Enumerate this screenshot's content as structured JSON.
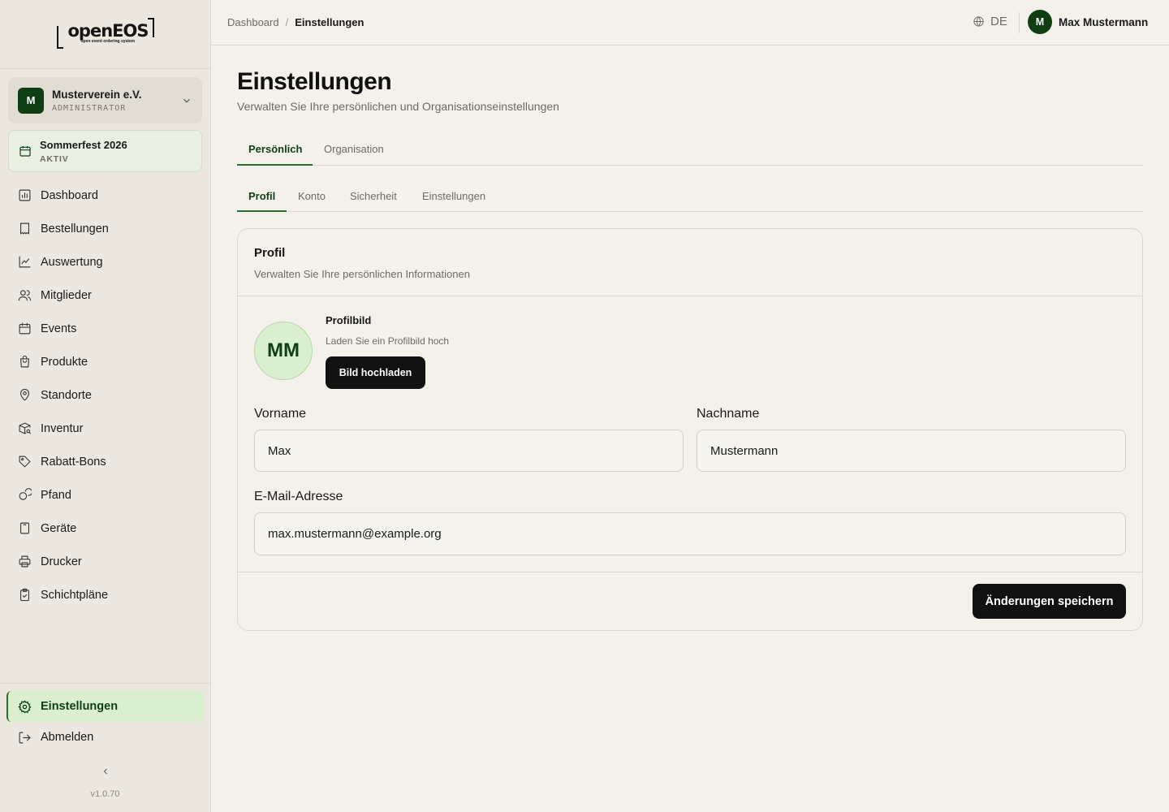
{
  "logo": {
    "text": "openEOS",
    "subtitle": "open event ordering system"
  },
  "org": {
    "initial": "M",
    "name": "Musterverein e.V.",
    "role": "ADMINISTRATOR"
  },
  "event": {
    "name": "Sommerfest 2026",
    "status": "AKTIV"
  },
  "sidebar": {
    "items": [
      {
        "label": "Dashboard",
        "icon": "chart-bar-icon"
      },
      {
        "label": "Bestellungen",
        "icon": "receipt-icon"
      },
      {
        "label": "Auswertung",
        "icon": "trend-line-icon"
      },
      {
        "label": "Mitglieder",
        "icon": "users-icon"
      },
      {
        "label": "Events",
        "icon": "calendar-icon"
      },
      {
        "label": "Produkte",
        "icon": "shopping-bag-icon"
      },
      {
        "label": "Standorte",
        "icon": "map-pin-icon"
      },
      {
        "label": "Inventur",
        "icon": "package-search-icon"
      },
      {
        "label": "Rabatt-Bons",
        "icon": "tag-icon"
      },
      {
        "label": "Pfand",
        "icon": "coins-icon"
      },
      {
        "label": "Geräte",
        "icon": "tablet-icon"
      },
      {
        "label": "Drucker",
        "icon": "printer-icon"
      },
      {
        "label": "Schichtpläne",
        "icon": "clipboard-check-icon"
      }
    ],
    "settings_label": "Einstellungen",
    "logout_label": "Abmelden",
    "version": "v1.0.70"
  },
  "topbar": {
    "breadcrumb": [
      "Dashboard",
      "Einstellungen"
    ],
    "language": "DE",
    "user_initial": "M",
    "user_name": "Max Mustermann"
  },
  "page": {
    "title": "Einstellungen",
    "subtitle": "Verwalten Sie Ihre persönlichen und Organisationseinstellungen"
  },
  "tabs_main": [
    {
      "label": "Persönlich",
      "active": true
    },
    {
      "label": "Organisation",
      "active": false
    }
  ],
  "tabs_sub": [
    {
      "label": "Profil",
      "active": true
    },
    {
      "label": "Konto",
      "active": false
    },
    {
      "label": "Sicherheit",
      "active": false
    },
    {
      "label": "Einstellungen",
      "active": false
    }
  ],
  "profile_card": {
    "title": "Profil",
    "description": "Verwalten Sie Ihre persönlichen Informationen",
    "avatar_initials": "MM",
    "picture_label": "Profilbild",
    "picture_hint": "Laden Sie ein Profilbild hoch",
    "upload_button": "Bild hochladen",
    "first_name_label": "Vorname",
    "first_name_value": "Max",
    "last_name_label": "Nachname",
    "last_name_value": "Mustermann",
    "email_label": "E-Mail-Adresse",
    "email_value": "max.mustermann@example.org",
    "save_button": "Änderungen speichern"
  },
  "colors": {
    "brand_dark": "#0f3d14",
    "accent_light": "#d9efcf",
    "background": "#f4f1eb"
  }
}
